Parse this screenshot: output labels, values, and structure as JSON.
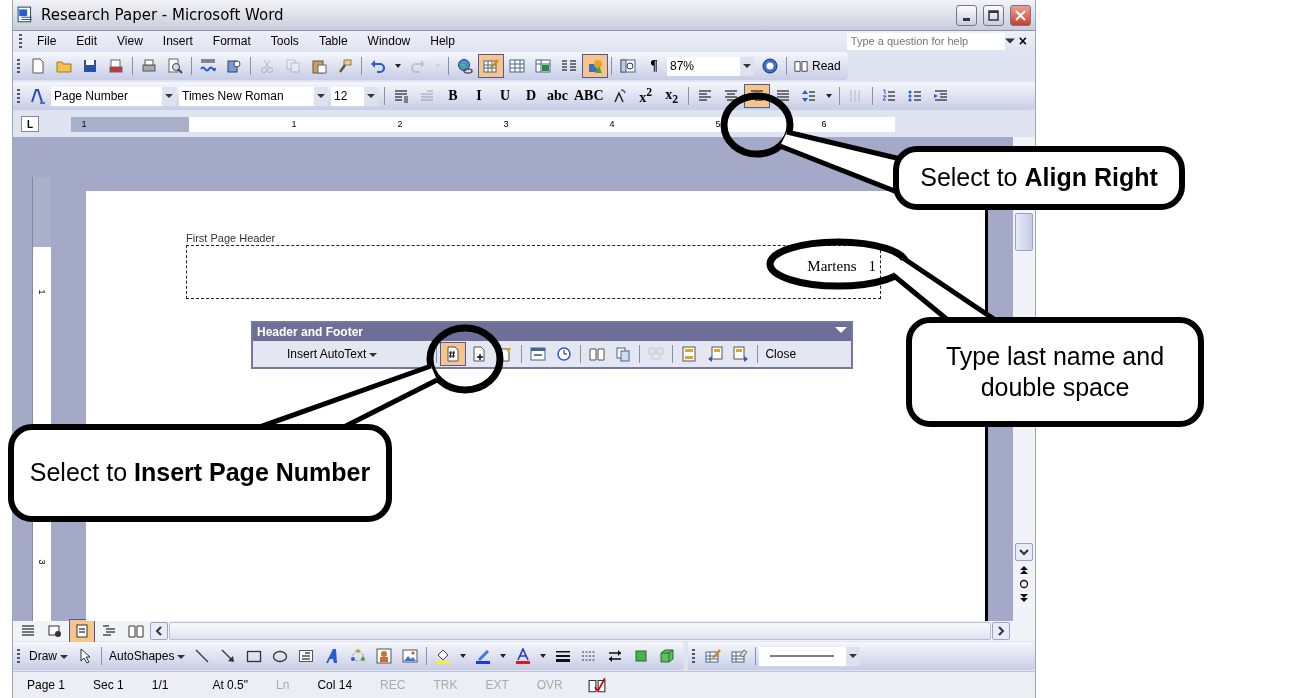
{
  "window": {
    "title": "Research Paper - Microsoft Word"
  },
  "menu": [
    "File",
    "Edit",
    "View",
    "Insert",
    "Format",
    "Tools",
    "Table",
    "Window",
    "Help"
  ],
  "help_box": {
    "placeholder": "Type a question for help",
    "close": "×"
  },
  "standard_toolbar": [
    {
      "kind": "new",
      "selected": false,
      "disabled": false
    },
    {
      "kind": "open",
      "selected": false,
      "disabled": false
    },
    {
      "kind": "save",
      "selected": false,
      "disabled": false
    },
    {
      "kind": "permission",
      "selected": false,
      "disabled": false
    },
    {
      "kind": "separator"
    },
    {
      "kind": "print",
      "selected": false,
      "disabled": false
    },
    {
      "kind": "preview",
      "selected": false,
      "disabled": false
    },
    {
      "kind": "separator"
    },
    {
      "kind": "spelling",
      "selected": false,
      "disabled": false
    },
    {
      "kind": "research",
      "selected": false,
      "disabled": false
    },
    {
      "kind": "separator"
    },
    {
      "kind": "cut",
      "selected": false,
      "disabled": true
    },
    {
      "kind": "copy",
      "selected": false,
      "disabled": true
    },
    {
      "kind": "paste",
      "selected": false,
      "disabled": false
    },
    {
      "kind": "painter",
      "selected": false,
      "disabled": false
    },
    {
      "kind": "separator"
    },
    {
      "kind": "undo",
      "selected": false,
      "disabled": false
    },
    {
      "kind": "caret",
      "selected": false,
      "disabled": false
    },
    {
      "kind": "redo",
      "selected": false,
      "disabled": true
    },
    {
      "kind": "caret",
      "selected": false,
      "disabled": true
    },
    {
      "kind": "separator"
    },
    {
      "kind": "hyperlink",
      "selected": false,
      "disabled": false
    },
    {
      "kind": "tables_borders",
      "selected": true,
      "disabled": false
    },
    {
      "kind": "table",
      "selected": false,
      "disabled": false
    },
    {
      "kind": "excel",
      "selected": false,
      "disabled": false
    },
    {
      "kind": "columns",
      "selected": false,
      "disabled": false
    },
    {
      "kind": "drawing",
      "selected": true,
      "disabled": false
    },
    {
      "kind": "separator"
    },
    {
      "kind": "docmap",
      "selected": false,
      "disabled": false
    },
    {
      "kind": "glyph",
      "text": "¶",
      "selected": false,
      "disabled": false
    }
  ],
  "zoom": "87%",
  "read_button": "Read",
  "formatting_toolbar": {
    "style": "Page Number",
    "font": "Times New Roman",
    "size": "12",
    "items": [
      {
        "kind": "show_formatting",
        "selected": false,
        "disabled": false
      },
      {
        "kind": "styles_list",
        "selected": false,
        "disabled": true
      },
      {
        "kind": "glyph",
        "text": "B",
        "selected": false,
        "disabled": false
      },
      {
        "kind": "glyph",
        "text": "I",
        "selected": false,
        "disabled": false
      },
      {
        "kind": "glyph",
        "text": "U",
        "selected": false,
        "disabled": false
      },
      {
        "kind": "glyph",
        "text": "D",
        "selected": false,
        "disabled": false
      },
      {
        "kind": "glyph",
        "text": "abc",
        "selected": false,
        "disabled": false
      },
      {
        "kind": "glyph",
        "text": "ABC",
        "selected": false,
        "disabled": false
      },
      {
        "kind": "char_scale",
        "selected": false,
        "disabled": false
      },
      {
        "kind": "glyph",
        "text": "x$^{2}$",
        "selected": false,
        "disabled": false
      },
      {
        "kind": "glyph",
        "text": "x$_{2}$",
        "selected": false,
        "disabled": false
      },
      {
        "kind": "separator"
      },
      {
        "kind": "align_left",
        "selected": false,
        "disabled": false
      },
      {
        "kind": "align_center",
        "selected": false,
        "disabled": false
      },
      {
        "kind": "align_right",
        "selected": true,
        "disabled": false
      },
      {
        "kind": "justify",
        "selected": false,
        "disabled": false
      },
      {
        "kind": "line_spacing",
        "selected": false,
        "disabled": false
      },
      {
        "kind": "caret",
        "selected": false,
        "disabled": false
      },
      {
        "kind": "separator"
      },
      {
        "kind": "distributed",
        "selected": false,
        "disabled": true
      },
      {
        "kind": "separator"
      },
      {
        "kind": "numbering",
        "selected": false,
        "disabled": false
      },
      {
        "kind": "bullets",
        "selected": false,
        "disabled": false
      },
      {
        "kind": "indent",
        "selected": false,
        "disabled": false
      }
    ]
  },
  "ruler": {
    "tab_button": "L",
    "labels": [
      "1",
      "1",
      "2",
      "3",
      "4",
      "5",
      "6"
    ]
  },
  "vertical_ruler": [
    "1",
    "3"
  ],
  "document": {
    "header_label": "First Page Header",
    "header_name": "Martens",
    "header_page": "1"
  },
  "header_footer_toolbar": {
    "title": "Header and Footer",
    "autotext": "Insert AutoText",
    "close": "Close",
    "items": [
      {
        "kind": "separator"
      },
      {
        "kind": "page_number",
        "selected": true,
        "disabled": false
      },
      {
        "kind": "page_count",
        "selected": false,
        "disabled": false
      },
      {
        "kind": "format_page_number",
        "selected": false,
        "disabled": false
      },
      {
        "kind": "separator"
      },
      {
        "kind": "date",
        "selected": false,
        "disabled": false
      },
      {
        "kind": "time",
        "selected": false,
        "disabled": false
      },
      {
        "kind": "separator"
      },
      {
        "kind": "page_setup",
        "selected": false,
        "disabled": false
      },
      {
        "kind": "show_text",
        "selected": false,
        "disabled": false
      },
      {
        "kind": "separator"
      },
      {
        "kind": "same_as_previous",
        "selected": false,
        "disabled": true
      },
      {
        "kind": "separator"
      },
      {
        "kind": "switch",
        "selected": false,
        "disabled": false
      },
      {
        "kind": "show_previous",
        "selected": false,
        "disabled": false
      },
      {
        "kind": "show_next",
        "selected": false,
        "disabled": false
      },
      {
        "kind": "separator"
      }
    ]
  },
  "view_buttons": [
    {
      "kind": "normal",
      "selected": false
    },
    {
      "kind": "web",
      "selected": false
    },
    {
      "kind": "print",
      "selected": true
    },
    {
      "kind": "outline",
      "selected": false
    },
    {
      "kind": "reading",
      "selected": false
    }
  ],
  "drawing_toolbar": {
    "draw": "Draw",
    "autoshapes": "AutoShapes",
    "items": [
      {
        "kind": "line",
        "selected": false,
        "disabled": false
      },
      {
        "kind": "arrow",
        "selected": false,
        "disabled": false
      },
      {
        "kind": "rectangle",
        "selected": false,
        "disabled": false
      },
      {
        "kind": "oval",
        "selected": false,
        "disabled": false
      },
      {
        "kind": "textbox",
        "selected": false,
        "disabled": false
      },
      {
        "kind": "wordart",
        "selected": false,
        "disabled": false
      },
      {
        "kind": "diagram",
        "selected": false,
        "disabled": false
      },
      {
        "kind": "clipart",
        "selected": false,
        "disabled": false
      },
      {
        "kind": "picture",
        "selected": false,
        "disabled": false
      },
      {
        "kind": "separator"
      },
      {
        "kind": "fill_color",
        "selected": false,
        "disabled": false
      },
      {
        "kind": "caret",
        "selected": false,
        "disabled": false
      },
      {
        "kind": "line_color",
        "selected": false,
        "disabled": false
      },
      {
        "kind": "caret",
        "selected": false,
        "disabled": false
      },
      {
        "kind": "font_color",
        "selected": false,
        "disabled": false
      },
      {
        "kind": "caret",
        "selected": false,
        "disabled": false
      },
      {
        "kind": "line_style",
        "selected": false,
        "disabled": false
      },
      {
        "kind": "dash_style",
        "selected": false,
        "disabled": false
      },
      {
        "kind": "arrow_style",
        "selected": false,
        "disabled": false
      },
      {
        "kind": "shadow",
        "selected": false,
        "disabled": false
      },
      {
        "kind": "three_d",
        "selected": false,
        "disabled": false
      }
    ],
    "tables_items": [
      {
        "kind": "draw_table",
        "selected": false,
        "disabled": false
      },
      {
        "kind": "eraser",
        "selected": false,
        "disabled": false
      }
    ]
  },
  "status_bar": [
    {
      "text": "Page 1",
      "disabled": false
    },
    {
      "text": "Sec 1",
      "disabled": false
    },
    {
      "text": "1/1",
      "disabled": false
    },
    {
      "text": "At 0.5\"",
      "disabled": false
    },
    {
      "text": "Ln",
      "disabled": true
    },
    {
      "text": "Col 14",
      "disabled": false
    },
    {
      "text": "REC",
      "disabled": true
    },
    {
      "text": "TRK",
      "disabled": true
    },
    {
      "text": "EXT",
      "disabled": true
    },
    {
      "text": "OVR",
      "disabled": true
    }
  ],
  "callouts": [
    {
      "text": "Select to **Align Right**"
    },
    {
      "text": "Type last name and double space"
    },
    {
      "text": "Select to **Insert Page Number**"
    }
  ]
}
